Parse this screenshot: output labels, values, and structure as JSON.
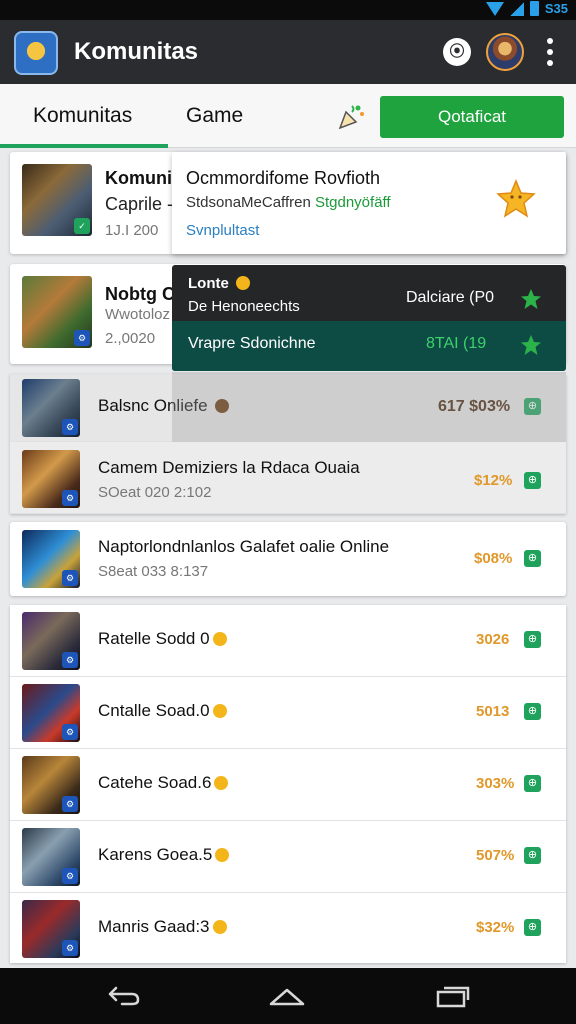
{
  "status_bar": {
    "clock": "S35"
  },
  "app_bar": {
    "title": "Komunitas"
  },
  "tabs": {
    "komunitas": "Komunitas",
    "game": "Game",
    "action_button": "Qotaficat"
  },
  "featured": [
    {
      "title": "Komuni",
      "subtitle": "Caprile -",
      "meta": "1J.I 200"
    },
    {
      "title": "Nobtg C",
      "subtitle": "Wwotoloz",
      "meta": "2.,0020"
    }
  ],
  "popup_light": {
    "line1": "Ocmmordifome Rovfioth",
    "line2": "StdsonaMeCaffren",
    "line2_accent": "Stgdnyöfäff",
    "line3": "Svnplultast"
  },
  "popup_dark": {
    "title": "Lonte",
    "subtitle": "De Henoneechts",
    "right_text": "Dalciare (P0",
    "bottom_text": "Vrapre Sdonichne",
    "bottom_value": "8TAI (19"
  },
  "rows": [
    {
      "title": "Balsnc Onliefe",
      "price": "617 $03%"
    },
    {
      "title": "Camem Demiziers la Rdaca Ouaia",
      "meta": "SOeat 020 2:102",
      "price": "$12%"
    },
    {
      "title": "Naptorlondnlanlos Galafet oalie Online",
      "meta": "S8eat 033 8:137",
      "price": "$08%"
    },
    {
      "title": "Ratelle Sodd 0",
      "price": "3026"
    },
    {
      "title": "Cntalle Soad.0",
      "price": "5013"
    },
    {
      "title": "Catehe Soad.6",
      "price": "303%"
    },
    {
      "title": "Karens Goea.5",
      "price": "507%"
    },
    {
      "title": "Manris Gaad:3",
      "price": "$32%"
    }
  ],
  "colors": {
    "accent_green": "#1fa33e",
    "app_bar": "#2b2c2f",
    "price_orange": "#e0982a",
    "popup_dark_bottom": "#0d4c45"
  }
}
